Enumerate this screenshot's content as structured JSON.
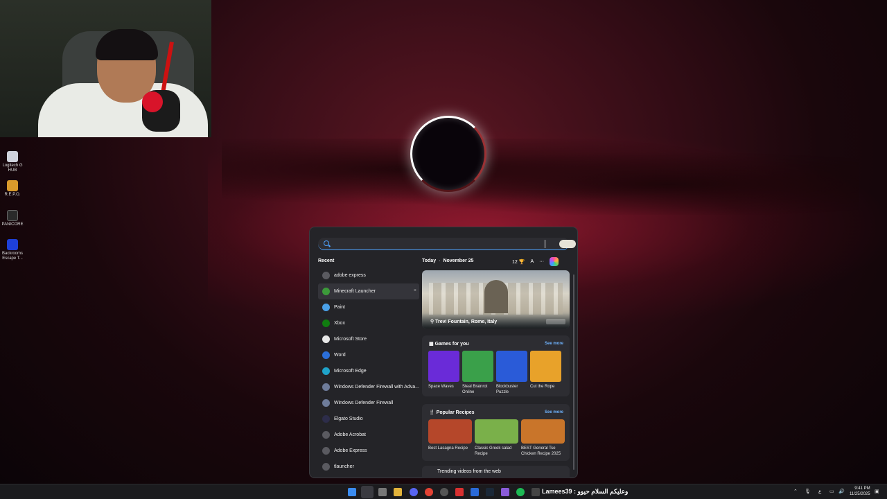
{
  "desktop": {
    "icons": [
      {
        "label": "Logitech G HUB",
        "icon": "logitech-icon",
        "color": "#cfd3dc"
      },
      {
        "label": "R.E.P.O.",
        "icon": "repo-icon",
        "color": "#d99a2b"
      },
      {
        "label": "PANICORE",
        "icon": "panicore-icon",
        "color": "#2a2a2a"
      },
      {
        "label": "Backrooms Escape T...",
        "icon": "backrooms-icon",
        "color": "#1e40d8"
      }
    ]
  },
  "search": {
    "placeholder": ""
  },
  "recent": {
    "title": "Recent",
    "items": [
      {
        "label": "adobe express",
        "icon": "search-result-icon",
        "color": "#5a5a60"
      },
      {
        "label": "Minecraft Launcher",
        "icon": "minecraft-icon",
        "color": "#3c9a3a",
        "remove": "×"
      },
      {
        "label": "Paint",
        "icon": "paint-icon",
        "color": "#4aa0e8"
      },
      {
        "label": "Xbox",
        "icon": "xbox-icon",
        "color": "#107c10"
      },
      {
        "label": "Microsoft Store",
        "icon": "store-icon",
        "color": "#e8e8e8"
      },
      {
        "label": "Word",
        "icon": "word-icon",
        "color": "#2b6fd8"
      },
      {
        "label": "Microsoft Edge",
        "icon": "edge-icon",
        "color": "#1fa3c9"
      },
      {
        "label": "Windows Defender Firewall with Adva...",
        "icon": "firewall-icon",
        "color": "#6e7c9a"
      },
      {
        "label": "Windows Defender Firewall",
        "icon": "firewall-icon",
        "color": "#6e7c9a"
      },
      {
        "label": "Elgato Studio",
        "icon": "elgato-icon",
        "color": "#2d2d4a"
      },
      {
        "label": "Adobe Acrobat",
        "icon": "search-result-icon",
        "color": "#5a5a60"
      },
      {
        "label": "Adobe Express",
        "icon": "search-result-icon",
        "color": "#5a5a60"
      },
      {
        "label": "tlauncher",
        "icon": "search-result-icon",
        "color": "#5a5a60"
      }
    ]
  },
  "today": {
    "label": "Today",
    "separator": "·",
    "date": "November 25",
    "points": "12",
    "font_label": "A",
    "more": "···"
  },
  "hero": {
    "location": "Trevi Fountain, Rome, Italy"
  },
  "games": {
    "title": "Games for you",
    "see_more": "See more",
    "items": [
      {
        "label": "Space Waves",
        "color": "#6a2bd8"
      },
      {
        "label": "Steal Brainrot Online",
        "color": "#3aa04a"
      },
      {
        "label": "Blockbuster Puzzle",
        "color": "#2a5bd8"
      },
      {
        "label": "Cut the Rope",
        "color": "#e8a22a"
      }
    ]
  },
  "recipes": {
    "title": "Popular Recipes",
    "see_more": "See more",
    "items": [
      {
        "label": "Best Lasagna Recipe",
        "color": "#b5472a"
      },
      {
        "label": "Classic Greek salad Recipe",
        "color": "#7ab04a"
      },
      {
        "label": "BEST General Tso Chicken Recipe 2025",
        "color": "#c9752a"
      }
    ]
  },
  "trending": {
    "title": "Trending videos from the web"
  },
  "taskbar": {
    "chat_message": "Lamees39 : وعليكم السلام حيوو",
    "input_indicator": "ع",
    "time": "9:41 PM",
    "date": "11/25/2025"
  }
}
